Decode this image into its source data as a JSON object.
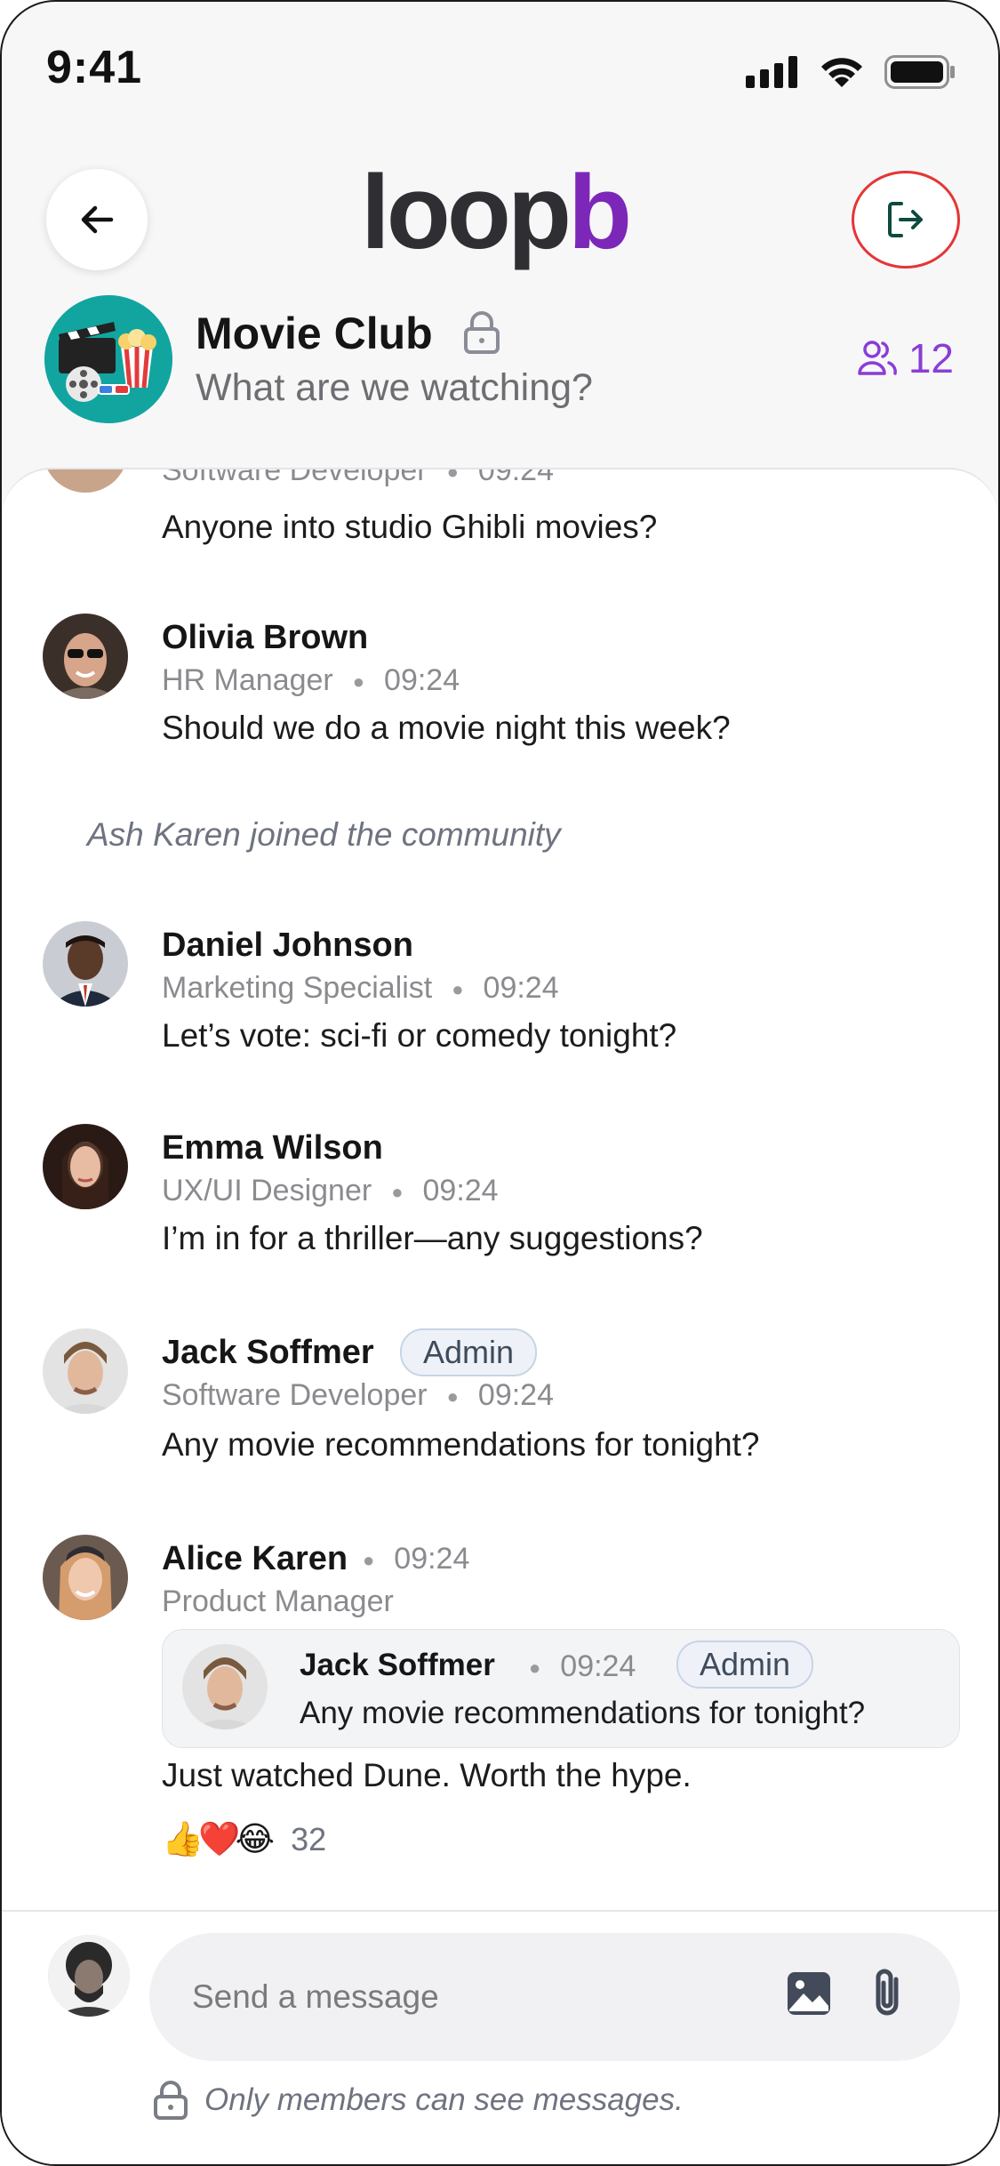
{
  "status_bar": {
    "time": "9:41"
  },
  "header": {
    "logo_main": "loop",
    "logo_accent": "b"
  },
  "group": {
    "name": "Movie Club",
    "description": "What are we watching?",
    "member_count": "12"
  },
  "messages": [
    {
      "author_role": "Software Developer",
      "time": "09:24",
      "text": "Anyone into studio Ghibli movies?"
    },
    {
      "author": "Olivia Brown",
      "author_role": "HR Manager",
      "time": "09:24",
      "text": "Should we do a movie night this week?"
    },
    {
      "system": "Ash Karen joined the community"
    },
    {
      "author": "Daniel Johnson",
      "author_role": "Marketing Specialist",
      "time": "09:24",
      "text": "Let’s vote: sci-fi or comedy tonight?"
    },
    {
      "author": "Emma Wilson",
      "author_role": "UX/UI Designer",
      "time": "09:24",
      "text": "I’m in for a thriller—any suggestions?"
    },
    {
      "author": "Jack Soffmer",
      "badge": "Admin",
      "author_role": "Software Developer",
      "time": "09:24",
      "text": "Any movie recommendations for tonight?"
    },
    {
      "author": "Alice Karen",
      "time": "09:24",
      "author_role": "Product Manager",
      "reply": {
        "author": "Jack Soffmer",
        "time": "09:24",
        "badge": "Admin",
        "text": "Any movie recommendations for tonight?"
      },
      "text": "Just watched Dune. Worth the hype.",
      "reactions": {
        "emojis": [
          "👍",
          "❤️",
          "😂"
        ],
        "count": "32"
      }
    }
  ],
  "composer": {
    "placeholder": "Send a message",
    "privacy_note": "Only members can see messages."
  },
  "colors": {
    "brand_purple": "#7d27b8",
    "leave_red": "#e53535",
    "member_purple": "#8a3dd6",
    "group_teal": "#12a5a0"
  },
  "icons": [
    "back-arrow-icon",
    "leave-icon",
    "lock-icon",
    "members-icon",
    "image-icon",
    "attachment-icon",
    "signal-icon",
    "wifi-icon",
    "battery-icon"
  ]
}
